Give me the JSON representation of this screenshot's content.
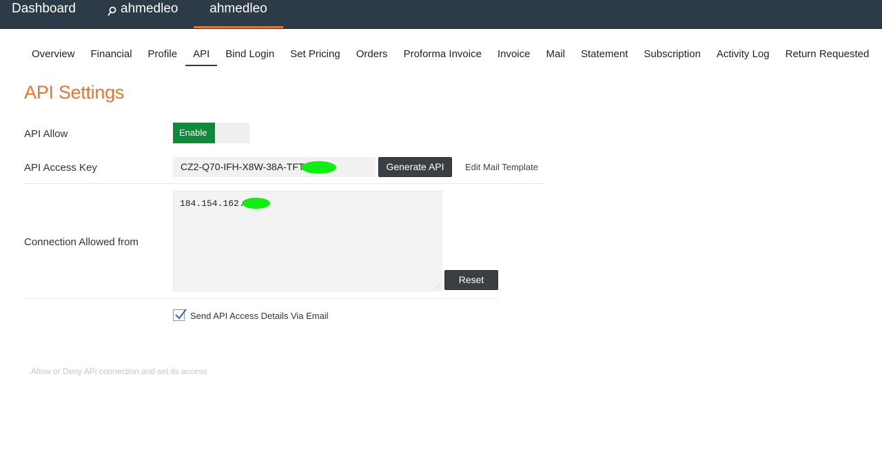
{
  "topbar": {
    "dashboard": "Dashboard",
    "search_user": "ahmedleo",
    "current_user": "ahmedleo",
    "accent_color": "#e8762b",
    "search_icon": "search-icon"
  },
  "tabs": [
    {
      "label": "Overview"
    },
    {
      "label": "Financial"
    },
    {
      "label": "Profile"
    },
    {
      "label": "API",
      "active": true
    },
    {
      "label": "Bind Login"
    },
    {
      "label": "Set Pricing"
    },
    {
      "label": "Orders"
    },
    {
      "label": "Proforma Invoice"
    },
    {
      "label": "Invoice"
    },
    {
      "label": "Mail"
    },
    {
      "label": "Statement"
    },
    {
      "label": "Subscription"
    },
    {
      "label": "Activity Log"
    },
    {
      "label": "Return Requested"
    }
  ],
  "page_title": "API Settings",
  "form": {
    "api_allow_label": "API Allow",
    "toggle_on_label": "Enable",
    "api_key_label": "API Access Key",
    "api_key_value": "CZ2-Q70-IFH-X8W-38A-TFT-",
    "generate_button": "Generate API",
    "edit_mail_template": "Edit Mail Template",
    "connection_label": "Connection Allowed from",
    "connection_value": "184.154.162.",
    "reset_button": "Reset",
    "send_email_label": "Send API Access Details Via Email",
    "send_email_checked": true
  },
  "help_text": "Allow or Deny APi connection and set its access"
}
